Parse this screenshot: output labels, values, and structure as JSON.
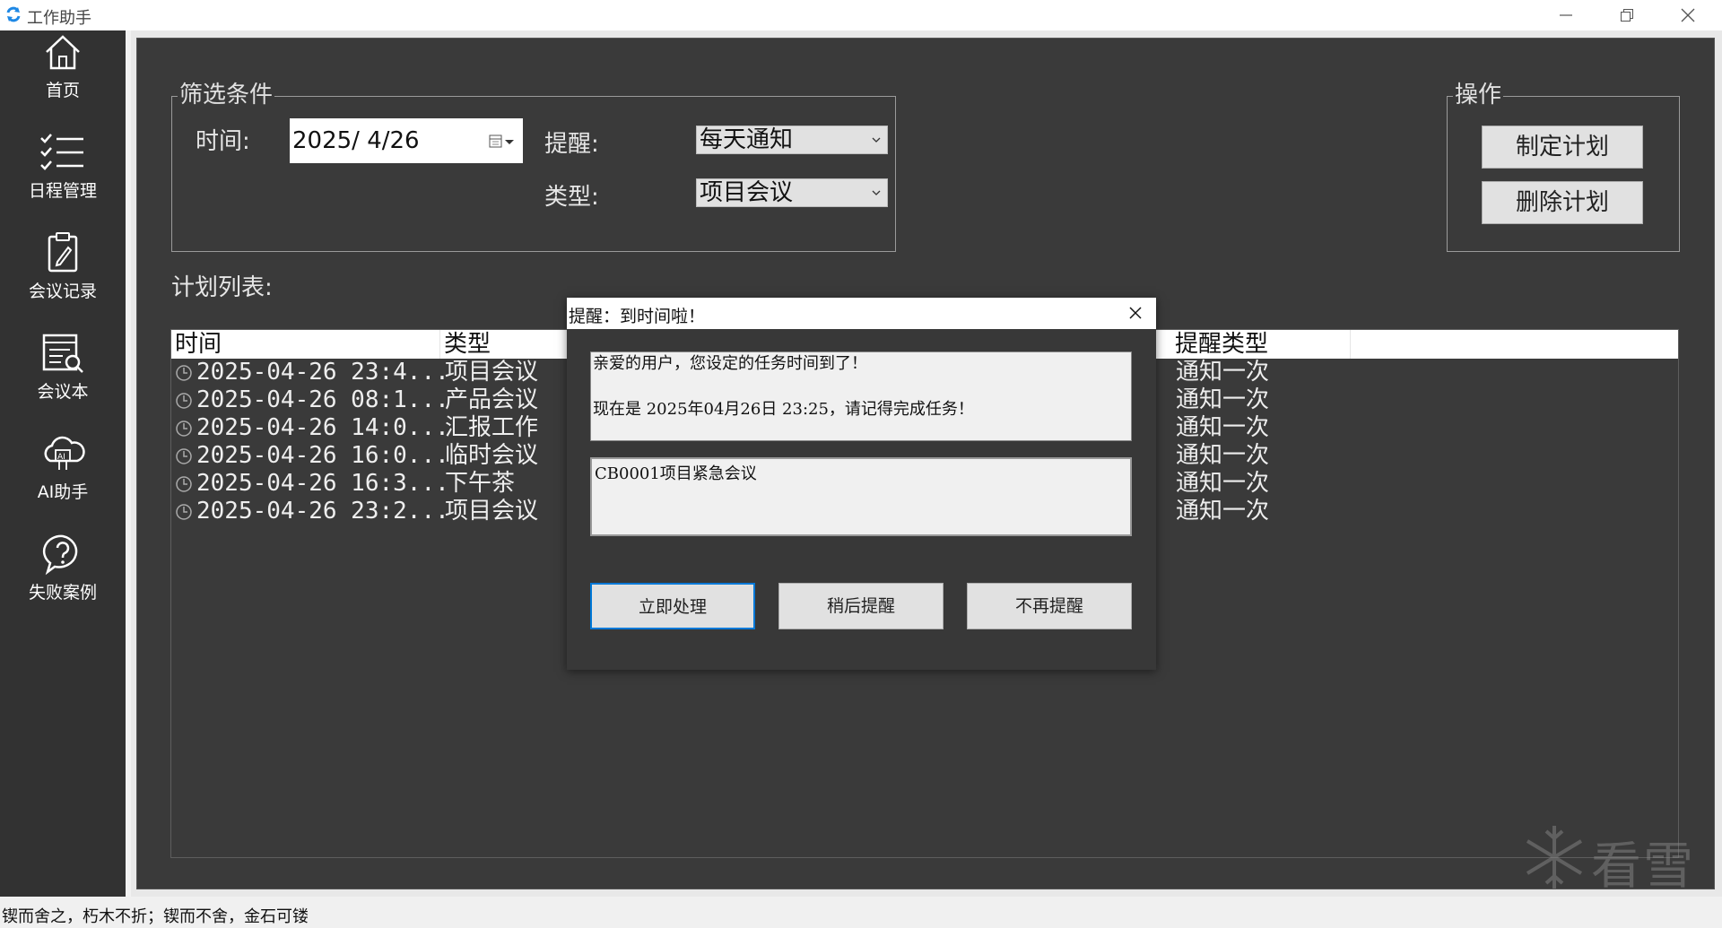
{
  "window": {
    "title": "工作助手",
    "minimize_icon": "minimize-icon",
    "restore_icon": "restore-icon",
    "close_icon": "close-icon"
  },
  "sidebar": {
    "items": [
      {
        "label": "首页",
        "icon": "home-icon"
      },
      {
        "label": "日程管理",
        "icon": "checklist-icon"
      },
      {
        "label": "会议记录",
        "icon": "clipboard-icon"
      },
      {
        "label": "会议本",
        "icon": "notebook-search-icon"
      },
      {
        "label": "AI助手",
        "icon": "ai-cloud-icon"
      },
      {
        "label": "失败案例",
        "icon": "question-bubble-icon"
      }
    ]
  },
  "filter": {
    "title": "筛选条件",
    "time_label": "时间:",
    "date_value": "2025/ 4/26",
    "remind_label": "提醒:",
    "remind_value": "每天通知",
    "type_label": "类型:",
    "type_value": "项目会议"
  },
  "operations": {
    "title": "操作",
    "create_button": "制定计划",
    "delete_button": "删除计划"
  },
  "plan_list": {
    "title": "计划列表:",
    "headers": {
      "time": "时间",
      "type": "类型",
      "remind_type": "提醒类型"
    },
    "rows": [
      {
        "time": "2025-04-26 23:4...",
        "type": "项目会议",
        "remind": "通知一次"
      },
      {
        "time": "2025-04-26 08:1...",
        "type": "产品会议",
        "remind": "通知一次"
      },
      {
        "time": "2025-04-26 14:0...",
        "type": "汇报工作",
        "remind": "通知一次"
      },
      {
        "time": "2025-04-26 16:0...",
        "type": "临时会议",
        "remind": "通知一次"
      },
      {
        "time": "2025-04-26 16:3...",
        "type": "下午茶",
        "remind": "通知一次"
      },
      {
        "time": "2025-04-26 23:2...",
        "type": "项目会议",
        "remind": "通知一次"
      }
    ]
  },
  "dialog": {
    "title": "提醒：到时间啦！",
    "message_line1": "亲爱的用户，您设定的任务时间到了！",
    "message_line2": "现在是 2025年04月26日 23:25，请记得完成任务！",
    "task_text": "CB0001项目紧急会议",
    "buttons": {
      "handle_now": "立即处理",
      "remind_later": "稍后提醒",
      "no_more": "不再提醒"
    }
  },
  "watermark": {
    "text": "看雪"
  },
  "status": {
    "text": "锲而舍之，朽木不折；锲而不舍，金石可镂"
  },
  "colors": {
    "sidebar_bg": "#323232",
    "panel_bg": "#3a3a3a",
    "accent": "#0078d7",
    "app_icon": "#1e88e5"
  }
}
